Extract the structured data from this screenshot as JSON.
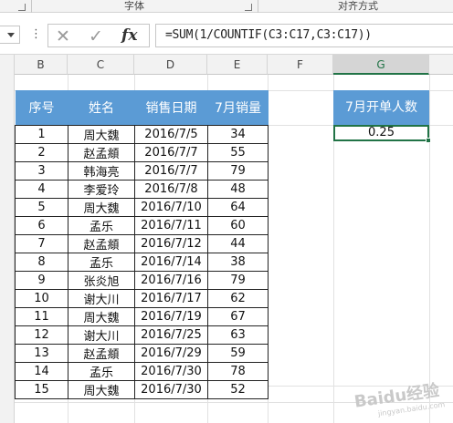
{
  "ribbon": {
    "group_font": "字体",
    "group_align": "对齐方式"
  },
  "formula_bar": {
    "menu_dots": "⋮",
    "cancel_symbol": "✕",
    "enter_symbol": "✓",
    "fx_label": "fx",
    "formula": "=SUM(1/COUNTIF(C3:C17,C3:C17))"
  },
  "columns": [
    "B",
    "C",
    "D",
    "E",
    "F",
    "G"
  ],
  "selected_column": "G",
  "table": {
    "headers": [
      "序号",
      "姓名",
      "销售日期",
      "7月销量"
    ],
    "rows": [
      [
        "1",
        "周大魏",
        "2016/7/5",
        "34"
      ],
      [
        "2",
        "赵孟頫",
        "2016/7/7",
        "55"
      ],
      [
        "3",
        "韩海亮",
        "2016/7/7",
        "79"
      ],
      [
        "4",
        "李爱玲",
        "2016/7/8",
        "48"
      ],
      [
        "5",
        "周大魏",
        "2016/7/10",
        "64"
      ],
      [
        "6",
        "孟乐",
        "2016/7/11",
        "60"
      ],
      [
        "7",
        "赵孟頫",
        "2016/7/12",
        "44"
      ],
      [
        "8",
        "孟乐",
        "2016/7/14",
        "38"
      ],
      [
        "9",
        "张炎旭",
        "2016/7/16",
        "79"
      ],
      [
        "10",
        "谢大川",
        "2016/7/17",
        "62"
      ],
      [
        "11",
        "周大魏",
        "2016/7/19",
        "67"
      ],
      [
        "12",
        "谢大川",
        "2016/7/25",
        "63"
      ],
      [
        "13",
        "赵孟頫",
        "2016/7/29",
        "59"
      ],
      [
        "14",
        "孟乐",
        "2016/7/30",
        "78"
      ],
      [
        "15",
        "周大魏",
        "2016/7/30",
        "52"
      ]
    ]
  },
  "result": {
    "header": "7月开单人数",
    "value": "0.25"
  },
  "watermark": {
    "brand": "Baidu经验",
    "url": "jingyan.baidu.com"
  },
  "colors": {
    "header_blue": "#5b9bd5",
    "excel_green": "#217346"
  }
}
